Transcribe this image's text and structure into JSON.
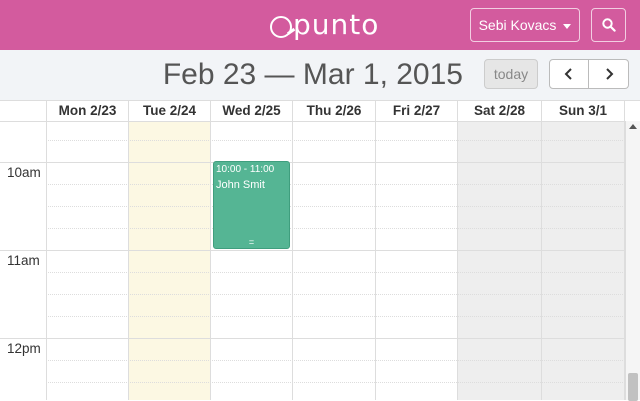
{
  "app": {
    "logo_text": "punto"
  },
  "header": {
    "user_name": "Sebi Kovacs",
    "user_icon": "caret-down-icon",
    "search_icon": "search-icon"
  },
  "toolbar": {
    "range_title": "Feb 23 — Mar 1, 2015",
    "today_label": "today",
    "prev_icon": "chevron-left-icon",
    "next_icon": "chevron-right-icon"
  },
  "calendar": {
    "days": [
      "Mon 2/23",
      "Tue 2/24",
      "Wed 2/25",
      "Thu 2/26",
      "Fri 2/27",
      "Sat 2/28",
      "Sun 3/1"
    ],
    "times": [
      "10am",
      "11am",
      "12pm"
    ],
    "today_index": 1,
    "weekend_indices": [
      5,
      6
    ],
    "colors": {
      "today_bg": "#fcf8e3",
      "weekend_bg": "#eeeeee",
      "event_bg": "#55b594",
      "header_bg": "#d35b9e"
    }
  },
  "event": {
    "time": "10:00 - 11:00",
    "title": "John Smit",
    "resize_glyph": "="
  }
}
